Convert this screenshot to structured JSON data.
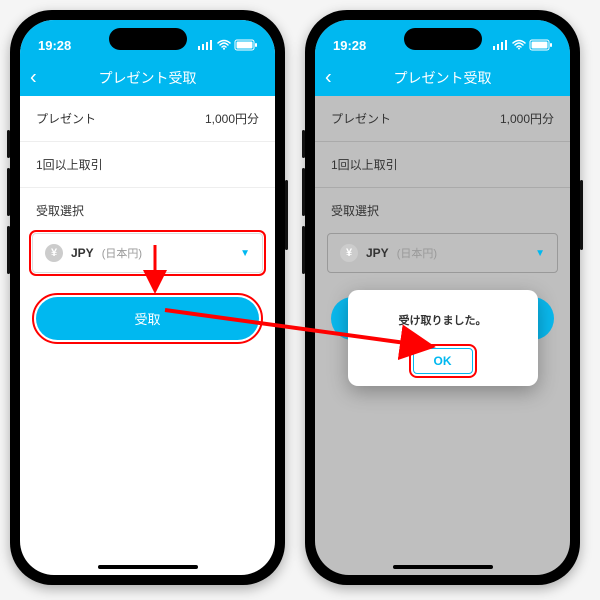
{
  "status": {
    "time": "19:28"
  },
  "header": {
    "title": "プレゼント受取"
  },
  "rows": {
    "present_label": "プレゼント",
    "present_value": "1,000円分",
    "condition": "1回以上取引"
  },
  "select": {
    "label": "受取選択",
    "currency_symbol": "¥",
    "currency_code": "JPY",
    "currency_name": "(日本円)"
  },
  "button": {
    "receive": "受取"
  },
  "modal": {
    "message": "受け取りました。",
    "ok": "OK"
  }
}
